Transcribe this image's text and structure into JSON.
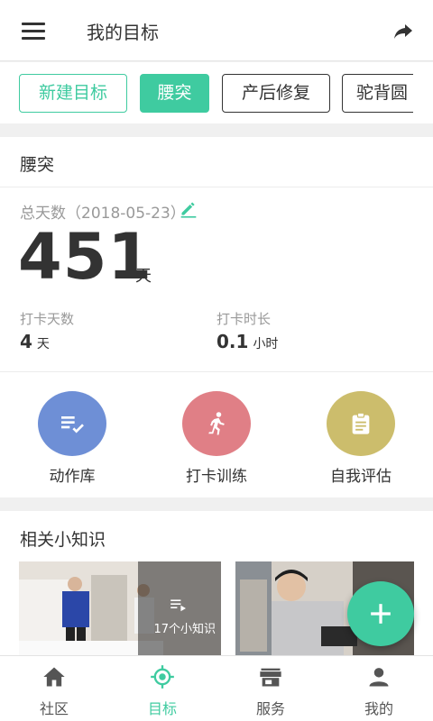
{
  "header": {
    "title": "我的目标",
    "menu_icon": "menu-icon",
    "share_icon": "share-icon"
  },
  "chips": {
    "new_label": "新建目标",
    "items": [
      "腰突",
      "产后修复",
      "驼背圆"
    ],
    "active": "腰突"
  },
  "goal": {
    "title": "腰突",
    "total_label": "总天数（2018-05-23）",
    "total_days": "451",
    "total_unit": "天",
    "checkin_days_label": "打卡天数",
    "checkin_days_value": "4",
    "checkin_days_unit": "天",
    "checkin_hours_label": "打卡时长",
    "checkin_hours_value": "0.1",
    "checkin_hours_unit": "小时"
  },
  "actions": [
    {
      "label": "动作库",
      "icon": "list-check-icon",
      "color": "#6e8fd6"
    },
    {
      "label": "打卡训练",
      "icon": "running-icon",
      "color": "#e07f86"
    },
    {
      "label": "自我评估",
      "icon": "clipboard-icon",
      "color": "#ccbd6c"
    }
  ],
  "knowledge": {
    "title": "相关小知识",
    "items": [
      {
        "count_label": "17个小知识"
      }
    ]
  },
  "fab": {
    "icon": "plus-icon"
  },
  "nav": {
    "items": [
      {
        "label": "社区",
        "icon": "home-icon"
      },
      {
        "label": "目标",
        "icon": "target-icon"
      },
      {
        "label": "服务",
        "icon": "store-icon"
      },
      {
        "label": "我的",
        "icon": "person-icon"
      }
    ],
    "active": "目标"
  },
  "colors": {
    "accent": "#3fcba0"
  }
}
